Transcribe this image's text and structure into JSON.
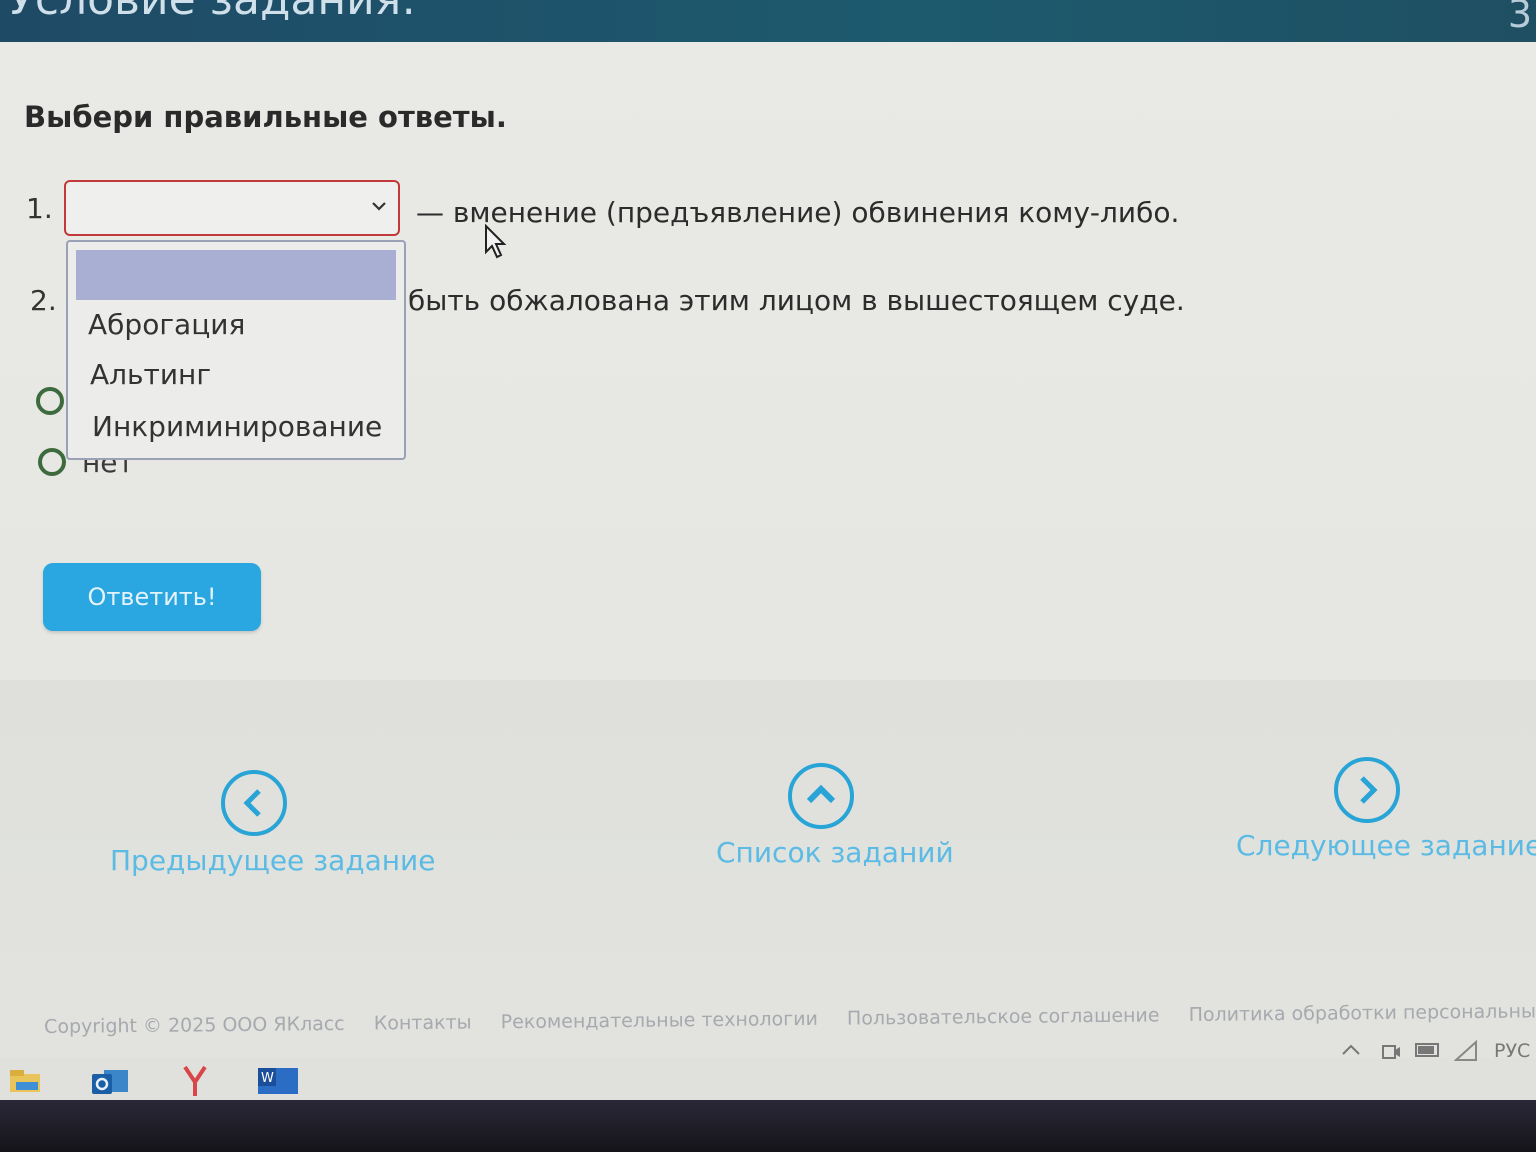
{
  "header": {
    "title": "Условие задания:",
    "number": "3"
  },
  "task": {
    "instruction": "Выбери правильные ответы.",
    "q1": {
      "number": "1.",
      "text": "— вменение (предъявление) обвинения кому-либо.",
      "select_value": "",
      "options": [
        "",
        "Аброгация",
        "Альтинг",
        "Инкриминирование"
      ]
    },
    "q2": {
      "number": "2.",
      "text": "быть обжалована этим лицом в вышестоящем суде.",
      "radio_no_label": "нет"
    },
    "submit_label": "Ответить!"
  },
  "nav": {
    "prev_label": "Предыдущее задание",
    "list_label": "Список заданий",
    "next_label": "Следующее задание"
  },
  "footer": {
    "copyright": "Copyright © 2025 ООО ЯКласс",
    "links": [
      "Контакты",
      "Рекомендательные технологии",
      "Пользовательское соглашение",
      "Политика обработки персональных данных"
    ]
  },
  "tray": {
    "lang": "РУС"
  },
  "colors": {
    "accent": "#2aa6e0",
    "nav_link": "#5bbbe4",
    "select_border": "#c2393c",
    "dropdown_highlight": "#a9aed3",
    "radio": "#3d6b3d"
  }
}
